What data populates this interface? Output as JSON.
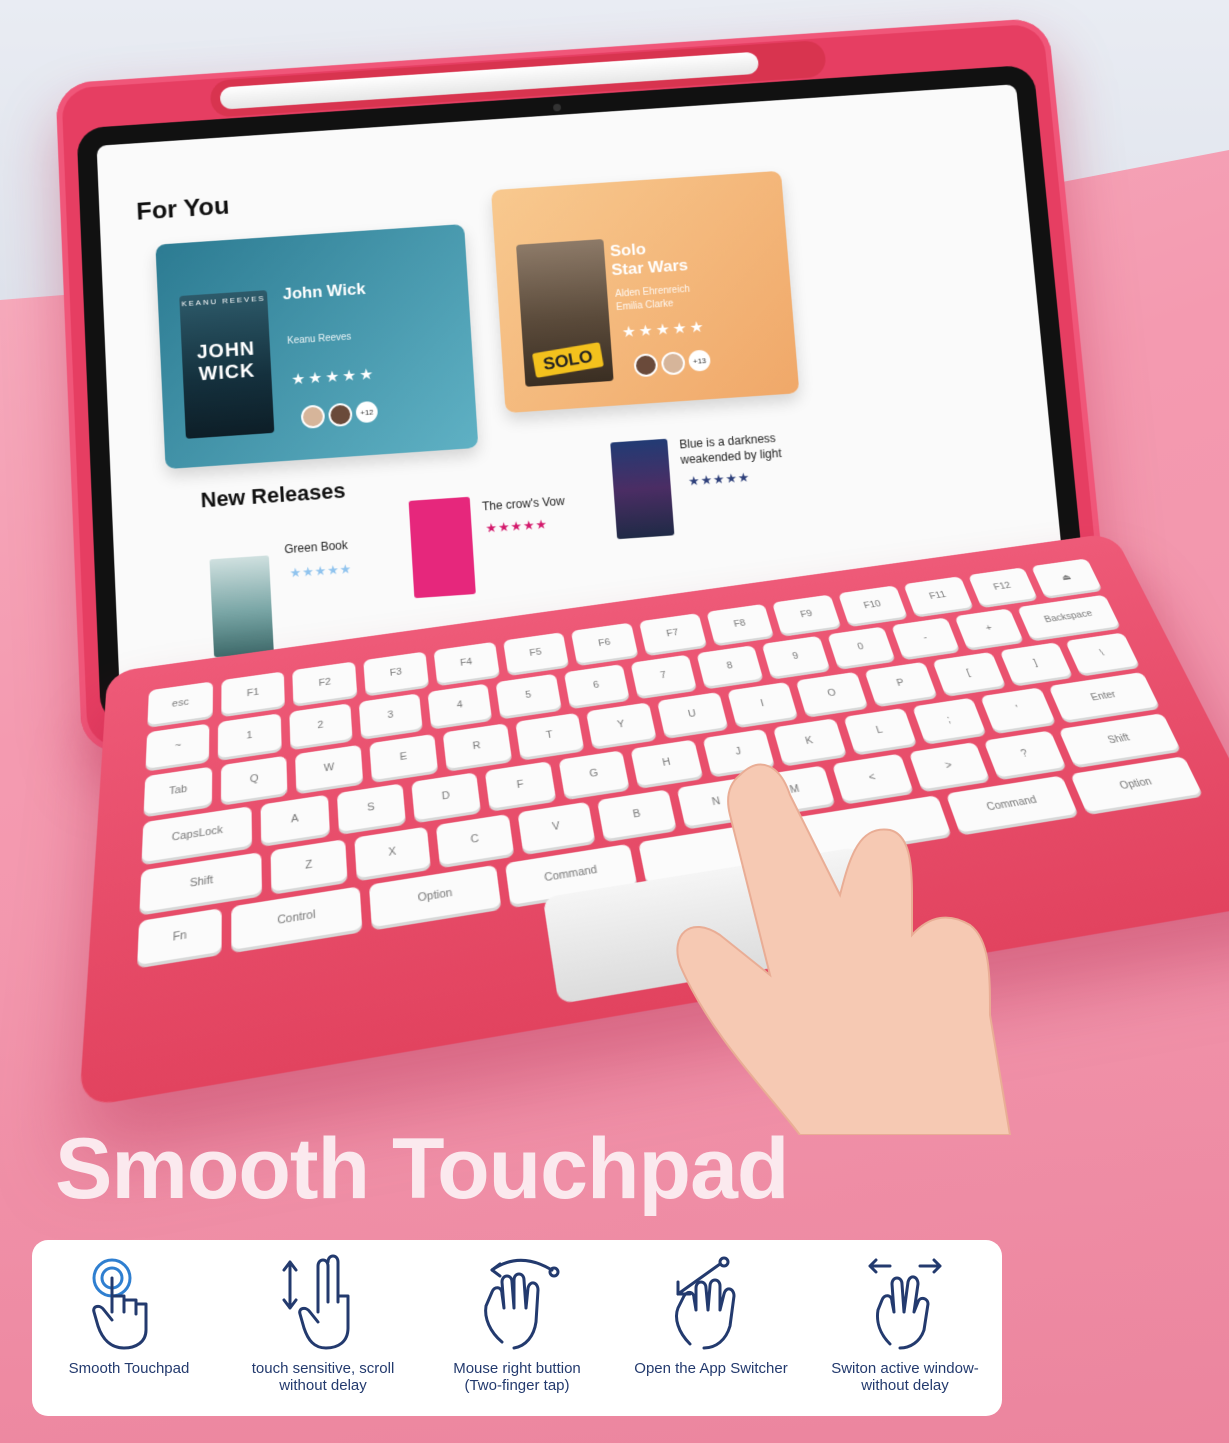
{
  "screen": {
    "for_you_title": "For You",
    "cards": [
      {
        "poster_top": "KEANU REEVES",
        "poster_title": "JOHN WICK",
        "title": "John Wick",
        "cast": "Keanu Reeves",
        "stars": "★★★★★",
        "extra_count": "+12"
      },
      {
        "poster_title": "SOLO",
        "title_line1": "Solo",
        "title_line2": "Star Wars",
        "cast_line1": "Alden Ehrenreich",
        "cast_line2": "Emilia Clarke",
        "stars": "★★★★★",
        "extra_count": "+13"
      }
    ],
    "new_releases_title": "New Releases",
    "books": [
      {
        "title": "Green Book",
        "stars": "★★★★★",
        "star_color": "#8fc3ee"
      },
      {
        "title": "The crow's Vow",
        "stars": "★★★★★",
        "star_color": "#d3186b"
      },
      {
        "title_line1": "Blue is a darkness",
        "title_line2": "weakended by light",
        "stars": "★★★★★",
        "star_color": "#2d3f7a"
      }
    ]
  },
  "keyboard": {
    "rows": [
      [
        "esc",
        "F1",
        "F2",
        "F3",
        "F4",
        "F5",
        "F6",
        "F7",
        "F8",
        "F9",
        "F10",
        "F11",
        "F12",
        "⏏"
      ],
      [
        "~",
        "1",
        "2",
        "3",
        "4",
        "5",
        "6",
        "7",
        "8",
        "9",
        "0",
        "-",
        "+",
        "Backspace"
      ],
      [
        "Tab",
        "Q",
        "W",
        "E",
        "R",
        "T",
        "Y",
        "U",
        "I",
        "O",
        "P",
        "[",
        "]",
        "\\"
      ],
      [
        "CapsLock",
        "A",
        "S",
        "D",
        "F",
        "G",
        "H",
        "J",
        "K",
        "L",
        ";",
        "'",
        "Enter"
      ],
      [
        "Shift",
        "Z",
        "X",
        "C",
        "V",
        "B",
        "N",
        "M",
        "<",
        ">",
        "?",
        "Shift"
      ],
      [
        "Fn",
        "Control",
        "Option",
        "Command",
        "",
        "Command",
        "Option"
      ]
    ]
  },
  "headline": "Smooth Touchpad",
  "features": [
    {
      "icon": "tap-finger-icon",
      "label_line1": "Smooth Touchpad",
      "label_line2": ""
    },
    {
      "icon": "two-finger-scroll-icon",
      "label_line1": "touch sensitive, scroll",
      "label_line2": "without delay"
    },
    {
      "icon": "two-finger-tap-icon",
      "label_line1": "Mouse right buttion",
      "label_line2": "(Two-finger tap)"
    },
    {
      "icon": "swipe-up-icon",
      "label_line1": "Open the App Switcher",
      "label_line2": ""
    },
    {
      "icon": "three-finger-swipe-icon",
      "label_line1": "Switon active window-",
      "label_line2": "without delay"
    }
  ],
  "colors": {
    "accent_pink": "#e63e62",
    "icon_navy": "#233a6e",
    "icon_blue": "#2f7fd0"
  }
}
